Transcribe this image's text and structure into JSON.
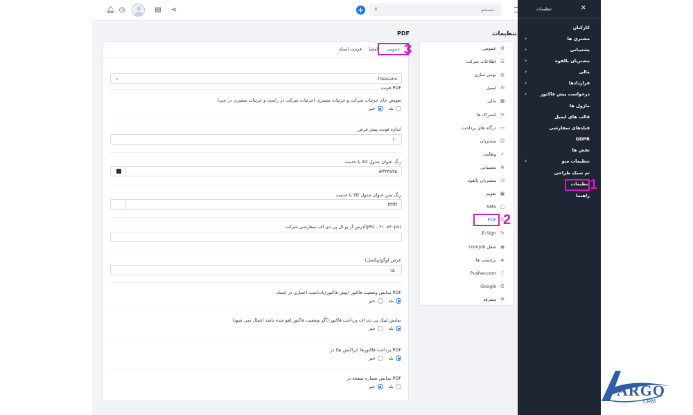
{
  "topbar": {
    "search_placeholder": "جستجو...",
    "icons": [
      "bell-icon",
      "clock-icon",
      "avatar",
      "clipboard-icon",
      "share-icon",
      "plus-icon",
      "search-icon",
      "menu-icon"
    ]
  },
  "sidebar": {
    "title": "تنظیمات",
    "close": "✕",
    "items": [
      {
        "label": "کارکنان",
        "chevron": false
      },
      {
        "label": "مشتری ها",
        "chevron": true
      },
      {
        "label": "پشتیبانی",
        "chevron": true
      },
      {
        "label": "مشتریان بالقوه",
        "chevron": true
      },
      {
        "label": "مالی",
        "chevron": true
      },
      {
        "label": "قراردادها",
        "chevron": true
      },
      {
        "label": "درخواست پیش فاکتور",
        "chevron": true
      },
      {
        "label": "ماژول ها",
        "chevron": false
      },
      {
        "label": "قالب های ایمیل",
        "chevron": false
      },
      {
        "label": "فیلدهای سفارشی",
        "chevron": false
      },
      {
        "label": "GDPR",
        "chevron": false
      },
      {
        "label": "نقش ها",
        "chevron": false
      },
      {
        "label": "تنظیمات منو",
        "chevron": true
      },
      {
        "label": "تم سبک طراحی",
        "chevron": false
      },
      {
        "label": "تنظیمات",
        "chevron": false
      },
      {
        "label": "راهنما",
        "chevron": false
      }
    ]
  },
  "page": {
    "settings_title": "تنظیمات",
    "section_title": "PDF"
  },
  "settings_nav": [
    {
      "label": "عمومی",
      "icon": "gear-icon",
      "glyph": "⚙"
    },
    {
      "label": "اطلاعات شرکت",
      "icon": "list-icon",
      "glyph": "☰"
    },
    {
      "label": "بومی سازی",
      "icon": "globe-icon",
      "glyph": "◍"
    },
    {
      "label": "ایمیل",
      "icon": "mail-icon",
      "glyph": "✉"
    },
    {
      "label": "مالی",
      "icon": "calculator-icon",
      "glyph": "▦"
    },
    {
      "label": "اشتراک ها",
      "icon": "refresh-icon",
      "glyph": "⟳"
    },
    {
      "label": "درگاه های پرداخت",
      "icon": "credit-card-icon",
      "glyph": "▭"
    },
    {
      "label": "مشتریان",
      "icon": "user-icon",
      "glyph": "☺"
    },
    {
      "label": "وظایف",
      "icon": "check-circle-icon",
      "glyph": "✓"
    },
    {
      "label": "پشتیبانی",
      "icon": "lifebuoy-icon",
      "glyph": "⊛"
    },
    {
      "label": "مشتریان بالقوه",
      "icon": "tty-icon",
      "glyph": "☏"
    },
    {
      "label": "تقویم",
      "icon": "calendar-icon",
      "glyph": "▣"
    },
    {
      "label": "SMS",
      "icon": "message-icon",
      "glyph": "▢"
    },
    {
      "label": "PDF",
      "icon": "pdf-icon",
      "glyph": "⎘",
      "active": true
    },
    {
      "label": "E-Sign",
      "icon": "signature-icon",
      "glyph": "✎"
    },
    {
      "label": "cronjob شغل",
      "icon": "terminal-icon",
      "glyph": "◉"
    },
    {
      "label": "برچسب ها",
      "icon": "tag-icon",
      "glyph": "◈"
    },
    {
      "label": "Pusher.com",
      "icon": "bell-icon",
      "glyph": "♪"
    },
    {
      "label": "Google",
      "icon": "google-icon",
      "glyph": "G"
    },
    {
      "label": "متفرقه",
      "icon": "cogs-icon",
      "glyph": "✲"
    }
  ],
  "tabs": [
    {
      "label": "عمومی",
      "active": true
    },
    {
      "label": "امضا",
      "active": false
    },
    {
      "label": "فرمت اسناد",
      "active": false
    }
  ],
  "form": {
    "pdf_font": {
      "label": "فونت PDF",
      "value": "freesans"
    },
    "swap_company_client": {
      "label": "تعویض جای جزئیات شرکت و جزئیات مشتری (جزئیات شرکت در راست و جزئیات مشتری در چپ)",
      "yes": "بله",
      "no": "خیر",
      "selected": "no"
    },
    "default_font_size": {
      "label": "اندازه فونت پیش فرض",
      "value": "۱۰"
    },
    "table_heading_color": {
      "label": "رنگ عنوان جدول کالا یا خدمت",
      "value": "#۳۲۳a۴۵",
      "swatch": "#323a45"
    },
    "table_heading_text_color": {
      "label": "رنگ متن عنوان جدول کالا یا خدمت",
      "value": "ffffff",
      "swatch": "#ffffff"
    },
    "custom_logo_url": {
      "label": "آدرس آر یو ال پی دی اف سفارشی شرکت(JPG - ۲۱۰x۴۰px)",
      "value": ""
    },
    "logo_width": {
      "label": "عرض لوگو(پیکسل)",
      "value": "۱۵۰"
    },
    "show_status": {
      "label": "نمایش وضعیت فاکتور /پیش فاکتور/یادداشت اعتباری در اسناد PDF",
      "yes": "بله",
      "no": "خیر",
      "selected": "yes"
    },
    "show_pay_link": {
      "label": "نمایش لینک پی دی اف پرداخت فاکتور (اگر وضعیت فاکتور لغو شده باشد اعمال نمی شود)",
      "yes": "بله",
      "no": "خیر",
      "selected": "yes"
    },
    "show_transactions": {
      "label": "پرداخت فاکتورها (تراکنش ها) در PDF",
      "yes": "بله",
      "no": "خیر",
      "selected": "yes"
    },
    "show_page_number": {
      "label": "نمایش شماره صفحه در PDF",
      "yes": "بله",
      "no": "خیر",
      "selected": "no"
    }
  },
  "annotations": {
    "n1": "1",
    "n2": "2",
    "n3": "3"
  },
  "logo": {
    "brand": "ARGO",
    "suffix": "CRM"
  },
  "colors": {
    "accent": "#1a73e8",
    "highlight": "#d419c8",
    "sidebar_bg": "#1f2633",
    "content_bg": "#f1f3f7"
  }
}
